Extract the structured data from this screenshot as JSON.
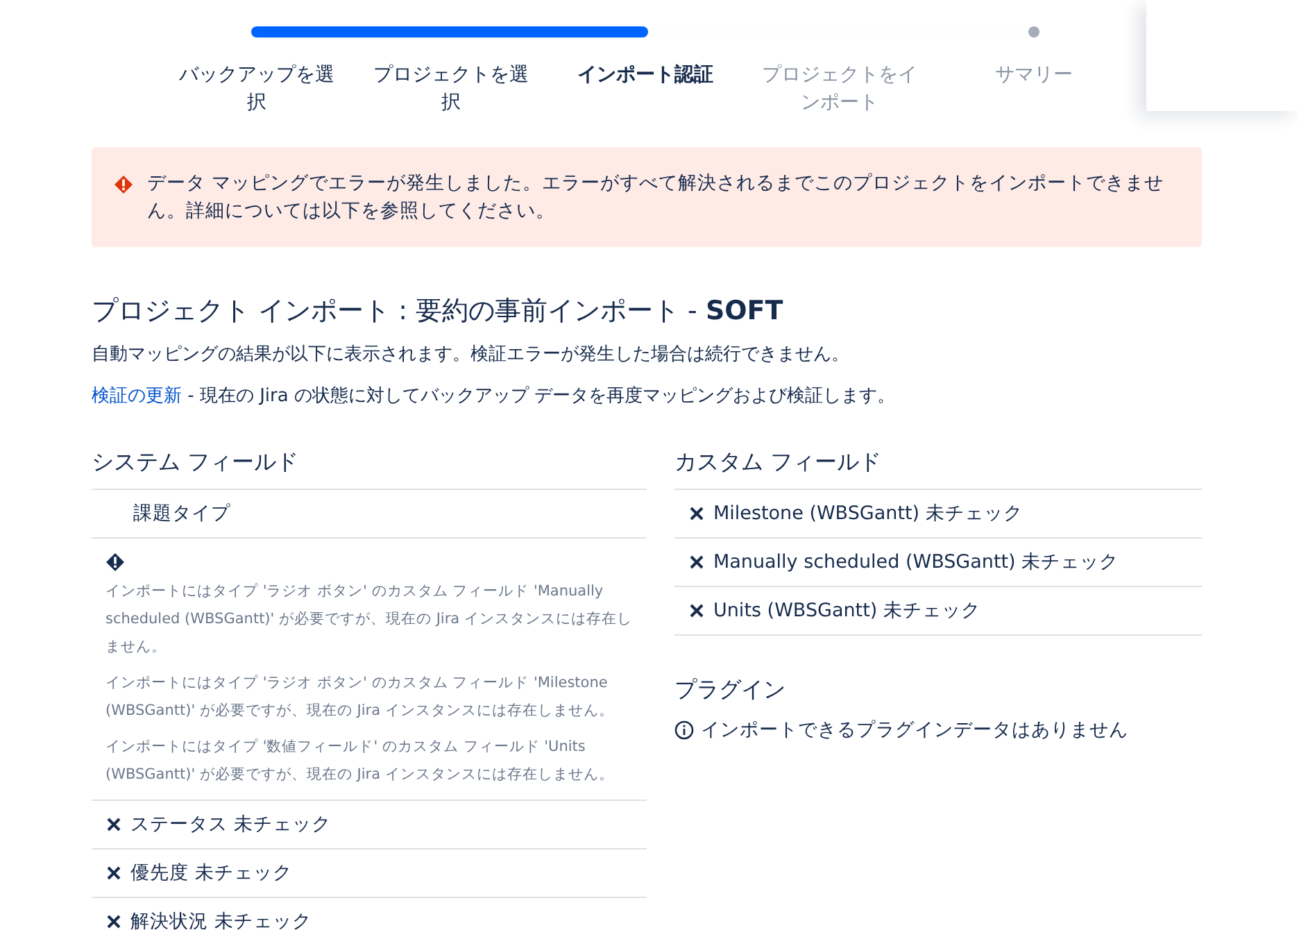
{
  "progress": {
    "level": 0.51
  },
  "steps": [
    {
      "label": "バックアップを選択",
      "reached": true,
      "selected": false
    },
    {
      "label": "プロジェクトを選択",
      "reached": true,
      "selected": false
    },
    {
      "label": "インポート認証",
      "reached": true,
      "selected": true
    },
    {
      "label": "プロジェクトをインポート",
      "reached": false,
      "selected": false
    },
    {
      "label": "サマリー",
      "reached": false,
      "selected": false
    }
  ],
  "alert": {
    "text": "データ マッピングでエラーが発生しました。エラーがすべて解決されるまでこのプロジェクトをインポートできません。詳細については以下を参照してください。"
  },
  "title": "プロジェクト インポート : 要約の事前インポート - **SOFT**",
  "description": "自動マッピングの結果が以下に表示されます。検証エラーが発生した場合は続行できません。",
  "refresh": {
    "link": "検証の更新",
    "text": " - 現在の Jira の状態に対してバックアップ データを再度マッピングおよび検証します。"
  },
  "system_fields": {
    "heading": "システム フィールド",
    "rows": [
      {
        "kind": "plain",
        "label": "課題タイプ"
      },
      {
        "kind": "error",
        "messages": [
          "インポートにはタイプ 'ラジオ ボタン' のカスタム フィールド 'Manually scheduled (WBSGantt)' が必要ですが、現在の Jira インスタンスには存在しません。",
          "インポートにはタイプ 'ラジオ ボタン' のカスタム フィールド 'Milestone (WBSGantt)' が必要ですが、現在の Jira インスタンスには存在しません。",
          "インポートにはタイプ '数値フィールド' のカスタム フィールド 'Units (WBSGantt)' が必要ですが、現在の Jira インスタンスには存在しません。"
        ]
      },
      {
        "kind": "unchecked",
        "label": "ステータス 未チェック"
      },
      {
        "kind": "unchecked",
        "label": "優先度 未チェック"
      },
      {
        "kind": "unchecked",
        "label": "解決状況 未チェック"
      }
    ]
  },
  "custom_fields": {
    "heading": "カスタム フィールド",
    "rows": [
      {
        "kind": "unchecked",
        "label": "Milestone (WBSGantt) 未チェック"
      },
      {
        "kind": "unchecked",
        "label": "Manually scheduled (WBSGantt) 未チェック"
      },
      {
        "kind": "unchecked",
        "label": "Units (WBSGantt) 未チェック"
      }
    ]
  },
  "plugins": {
    "heading": "プラグイン",
    "message": "インポートできるプラグインデータはありません"
  }
}
